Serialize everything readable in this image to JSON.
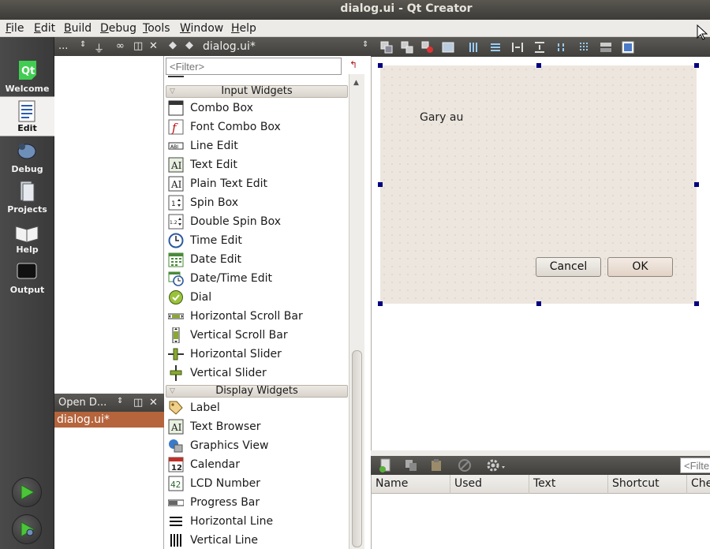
{
  "window": {
    "title": "dialog.ui - Qt Creator"
  },
  "menubar": {
    "items": [
      "File",
      "Edit",
      "Build",
      "Debug",
      "Tools",
      "Window",
      "Help"
    ]
  },
  "modes": [
    {
      "label": "Welcome",
      "icon": "qt-logo-icon"
    },
    {
      "label": "Edit",
      "icon": "edit-document-icon",
      "active": true
    },
    {
      "label": "Debug",
      "icon": "bug-icon"
    },
    {
      "label": "Projects",
      "icon": "projects-icon"
    },
    {
      "label": "Help",
      "icon": "book-icon"
    },
    {
      "label": "Output",
      "icon": "monitor-icon"
    }
  ],
  "navigation": {
    "header_text": "...",
    "open_documents": {
      "title": "Open D...",
      "items": [
        "dialog.ui*"
      ]
    }
  },
  "widgetbox": {
    "document_title": "dialog.ui*",
    "filter_placeholder": "<Filter>",
    "categories": [
      {
        "name": "Input Widgets",
        "items": [
          "Combo Box",
          "Font Combo Box",
          "Line Edit",
          "Text Edit",
          "Plain Text Edit",
          "Spin Box",
          "Double Spin Box",
          "Time Edit",
          "Date Edit",
          "Date/Time Edit",
          "Dial",
          "Horizontal Scroll Bar",
          "Vertical Scroll Bar",
          "Horizontal Slider",
          "Vertical Slider"
        ]
      },
      {
        "name": "Display Widgets",
        "items": [
          "Label",
          "Text Browser",
          "Graphics View",
          "Calendar",
          "LCD Number",
          "Progress Bar",
          "Horizontal Line",
          "Vertical Line"
        ]
      }
    ]
  },
  "form": {
    "label_text": "Gary au",
    "cancel_label": "Cancel",
    "ok_label": "OK"
  },
  "action_editor": {
    "filter_placeholder": "<Filte",
    "columns": [
      "Name",
      "Used",
      "Text",
      "Shortcut",
      "Che"
    ]
  },
  "colors": {
    "title_bar": "#3c3b37",
    "mode_bar": "#404040",
    "selection": "#b5643c",
    "form_background": "#ede6de",
    "handle": "#000080"
  }
}
